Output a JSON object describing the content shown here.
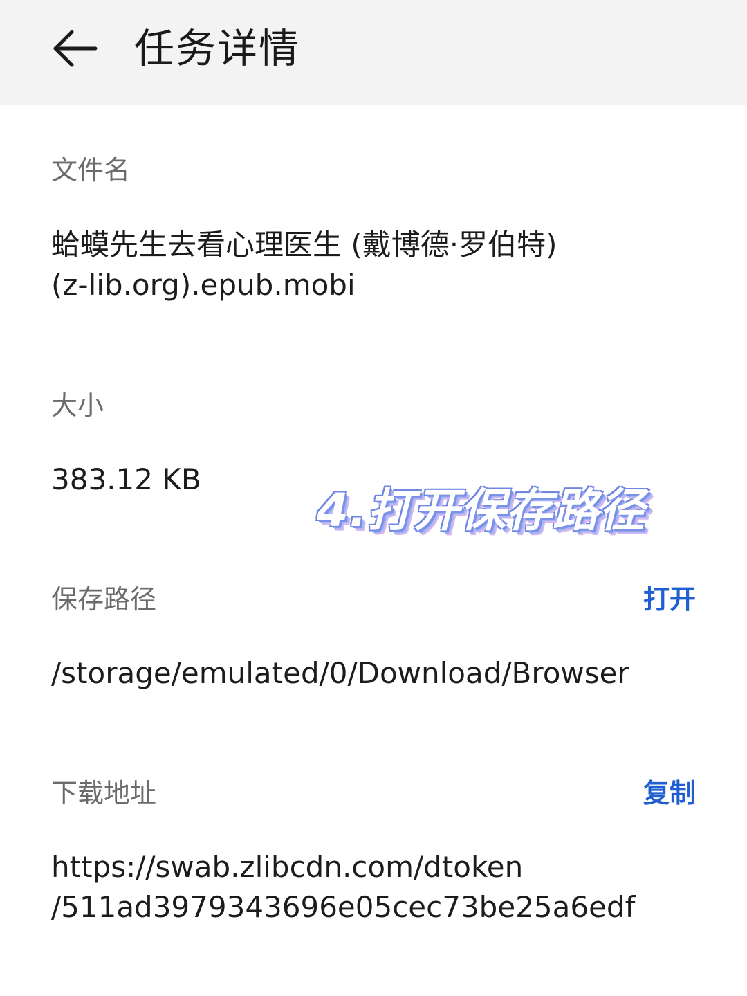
{
  "header": {
    "title": "任务详情"
  },
  "filename": {
    "label": "文件名",
    "value_line1": "蛤蟆先生去看心理医生 (戴博德·罗伯特)",
    "value_line2": "(z-lib.org).epub.mobi"
  },
  "size": {
    "label": "大小",
    "value": "383.12 KB"
  },
  "overlay": {
    "caption": "4.打开保存路径"
  },
  "save_path": {
    "label": "保存路径",
    "action_label": "打开",
    "value": "/storage/emulated/0/Download/Browser"
  },
  "download_url": {
    "label": "下载地址",
    "action_label": "复制",
    "value_line1": "https://swab.zlibcdn.com/dtoken",
    "value_line2": "/511ad3979343696e05cec73be25a6edf"
  },
  "colors": {
    "header_bg": "#f3f3f3",
    "accent": "#1f5fd1",
    "label_text": "#6b6b6b",
    "value_text": "#1c1c1c"
  },
  "icons": {
    "back": "arrow-left-icon"
  }
}
